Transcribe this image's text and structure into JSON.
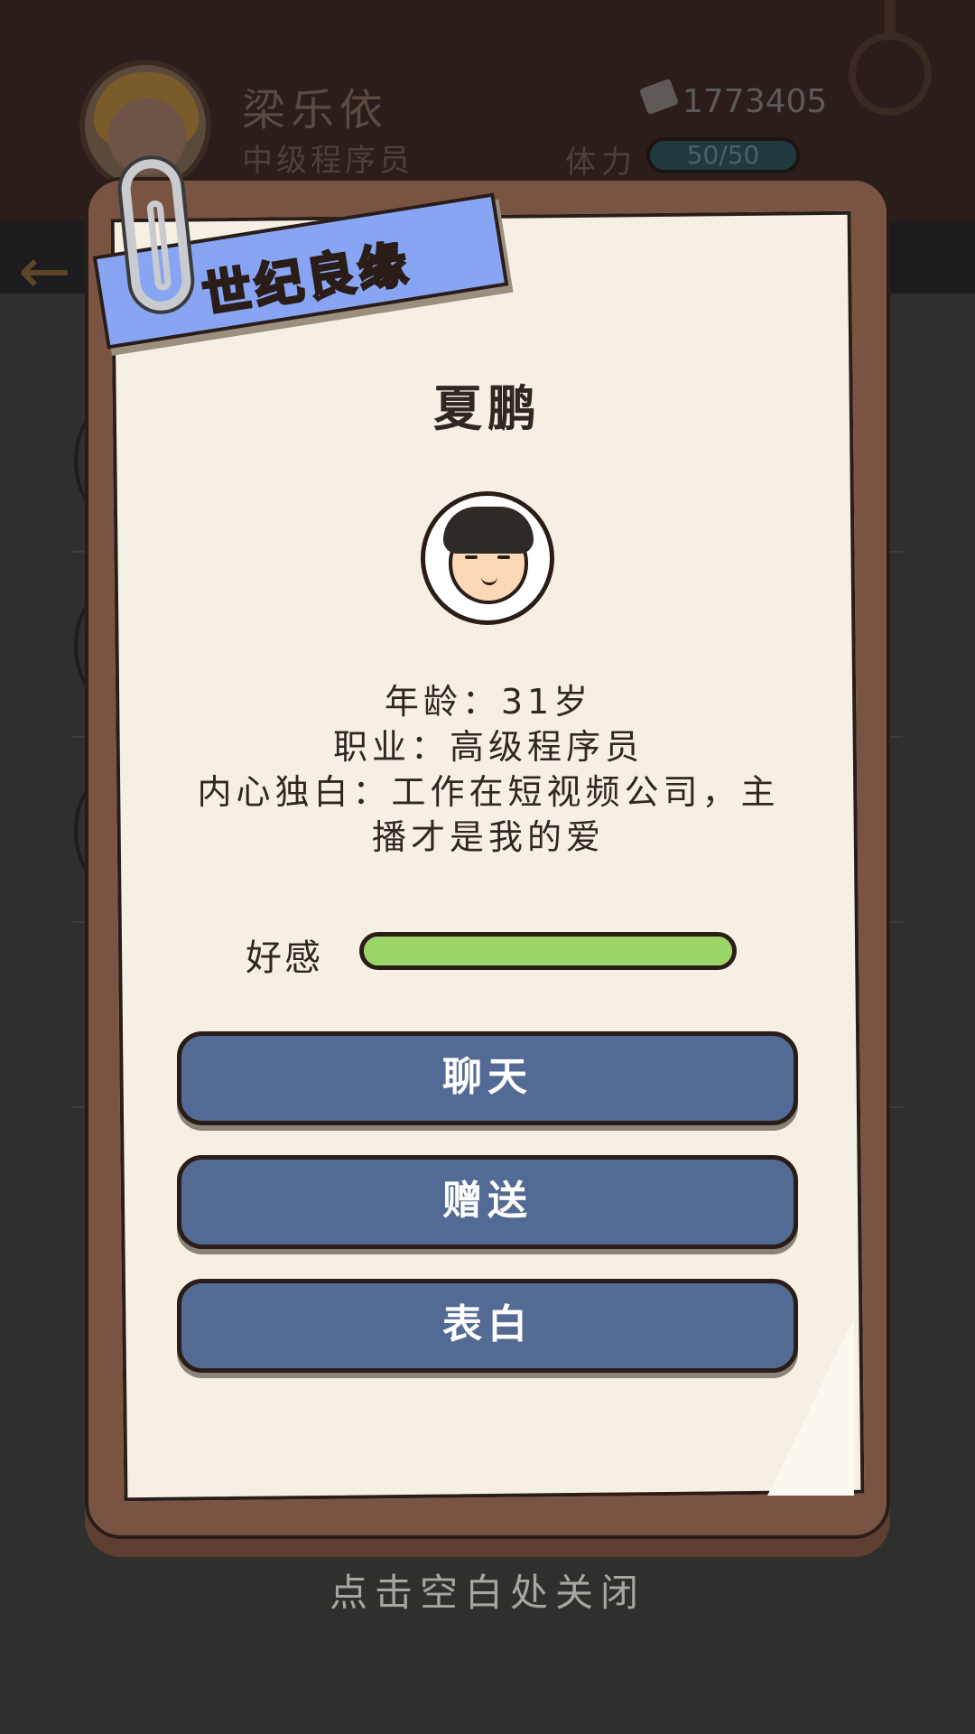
{
  "header": {
    "player_name": "梁乐依",
    "player_role": "中级程序员",
    "money": "1773405",
    "stamina_label": "体力",
    "stamina_value": "50/50",
    "stamina_fraction": 1.0
  },
  "ribbon_title": "世纪良缘",
  "character": {
    "name": "夏鹏",
    "age_line": "年龄：31岁",
    "job_line": "职业：高级程序员",
    "monologue_line1": "内心独白：工作在短视频公司，主",
    "monologue_line2": "播才是我的爱"
  },
  "favor": {
    "label": "好感",
    "fraction": 1.0,
    "color": "#9ad567"
  },
  "buttons": {
    "chat": "聊天",
    "gift": "赠送",
    "confess": "表白"
  },
  "close_hint": "点击空白处关闭",
  "colors": {
    "button": "#536a94",
    "ribbon": "#88a5f4",
    "board": "#7a5443",
    "paper": "#f6f0e4"
  },
  "icons": {
    "back": "back-arrow-icon",
    "money": "banknote-icon",
    "clip": "paperclip-icon",
    "ring": "ring-icon"
  }
}
